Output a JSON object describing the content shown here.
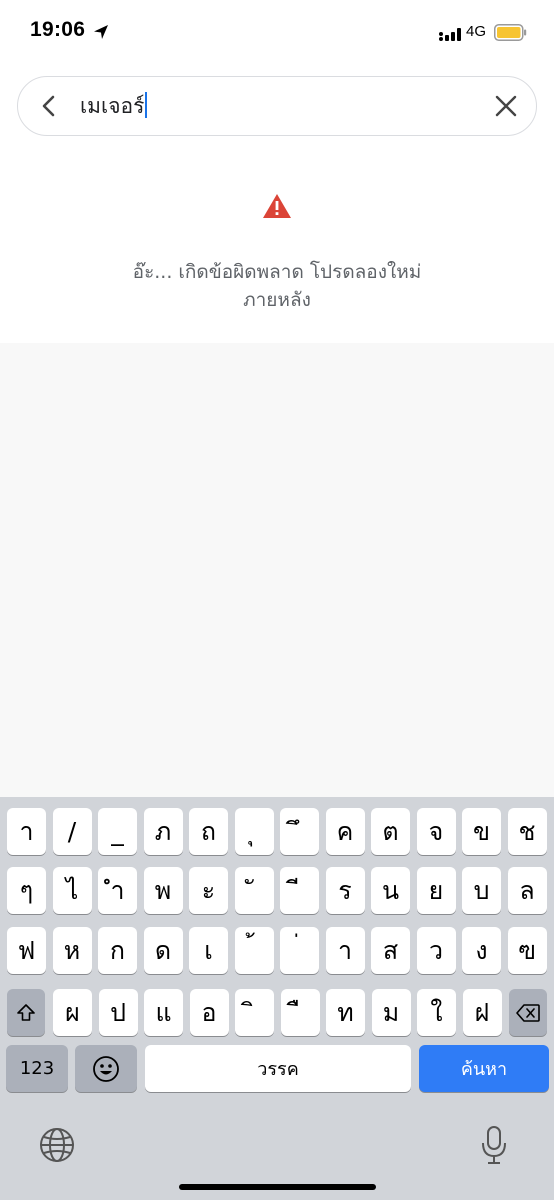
{
  "status_bar": {
    "time": "19:06",
    "network": "4G",
    "battery_color": "#f7c431",
    "icons": [
      "location-arrow-icon",
      "signal-bars-icon",
      "battery-icon"
    ]
  },
  "search": {
    "query": "เมเจอร์",
    "back_icon": "chevron-left-icon",
    "clear_icon": "close-icon",
    "caret_color": "#1a73e8"
  },
  "error": {
    "icon": "warning-triangle-icon",
    "icon_color": "#db4437",
    "message_line1": "อ๊ะ... เกิดข้อผิดพลาด โปรดลองใหม่",
    "message_line2": "ภายหลัง"
  },
  "keyboard": {
    "row1": [
      "า",
      "/",
      "_",
      "ภ",
      "ถ",
      "ุ",
      "ึ",
      "ค",
      "ต",
      "จ",
      "ข",
      "ช"
    ],
    "row2": [
      "ๆ",
      "ไ",
      "ำ",
      "พ",
      "ะ",
      "ั",
      "ี",
      "ร",
      "น",
      "ย",
      "บ",
      "ล"
    ],
    "row3": [
      "ฟ",
      "ห",
      "ก",
      "ด",
      "เ",
      "้",
      "่",
      "า",
      "ส",
      "ว",
      "ง",
      "ฃ"
    ],
    "row4": [
      "ผ",
      "ป",
      "แ",
      "อ",
      "ิ",
      "ื",
      "ท",
      "ม",
      "ใ",
      "ฝ"
    ],
    "shift_icon": "shift-icon",
    "backspace_icon": "backspace-icon",
    "numbers_label": "123",
    "emoji_icon": "emoji-icon",
    "space_label": "วรรค",
    "search_label": "ค้นหา",
    "globe_icon": "globe-icon",
    "mic_icon": "microphone-icon",
    "accent_color": "#2f7cf6"
  }
}
